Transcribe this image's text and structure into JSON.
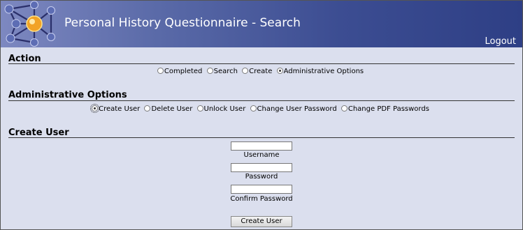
{
  "header": {
    "title": "Personal History Questionnaire - Search",
    "logout_label": "Logout"
  },
  "action": {
    "heading": "Action",
    "options": [
      {
        "label": "Completed",
        "checked": false
      },
      {
        "label": "Search",
        "checked": false
      },
      {
        "label": "Create",
        "checked": false
      },
      {
        "label": "Administrative Options",
        "checked": true
      }
    ]
  },
  "admin": {
    "heading": "Administrative Options",
    "options": [
      {
        "label": "Create User",
        "checked": true
      },
      {
        "label": "Delete User",
        "checked": false
      },
      {
        "label": "Unlock User",
        "checked": false
      },
      {
        "label": "Change User Password",
        "checked": false
      },
      {
        "label": "Change PDF Passwords",
        "checked": false
      }
    ]
  },
  "create_user": {
    "heading": "Create User",
    "username_label": "Username",
    "username_value": "",
    "password_label": "Password",
    "password_value": "",
    "confirm_label": "Confirm Password",
    "confirm_value": "",
    "submit_label": "Create User"
  },
  "colors": {
    "header_dark": "#2e3f85",
    "header_light": "#7d88c0",
    "page_bg": "#dbdfee"
  },
  "icons": {
    "logo": "molecule-network-logo"
  }
}
